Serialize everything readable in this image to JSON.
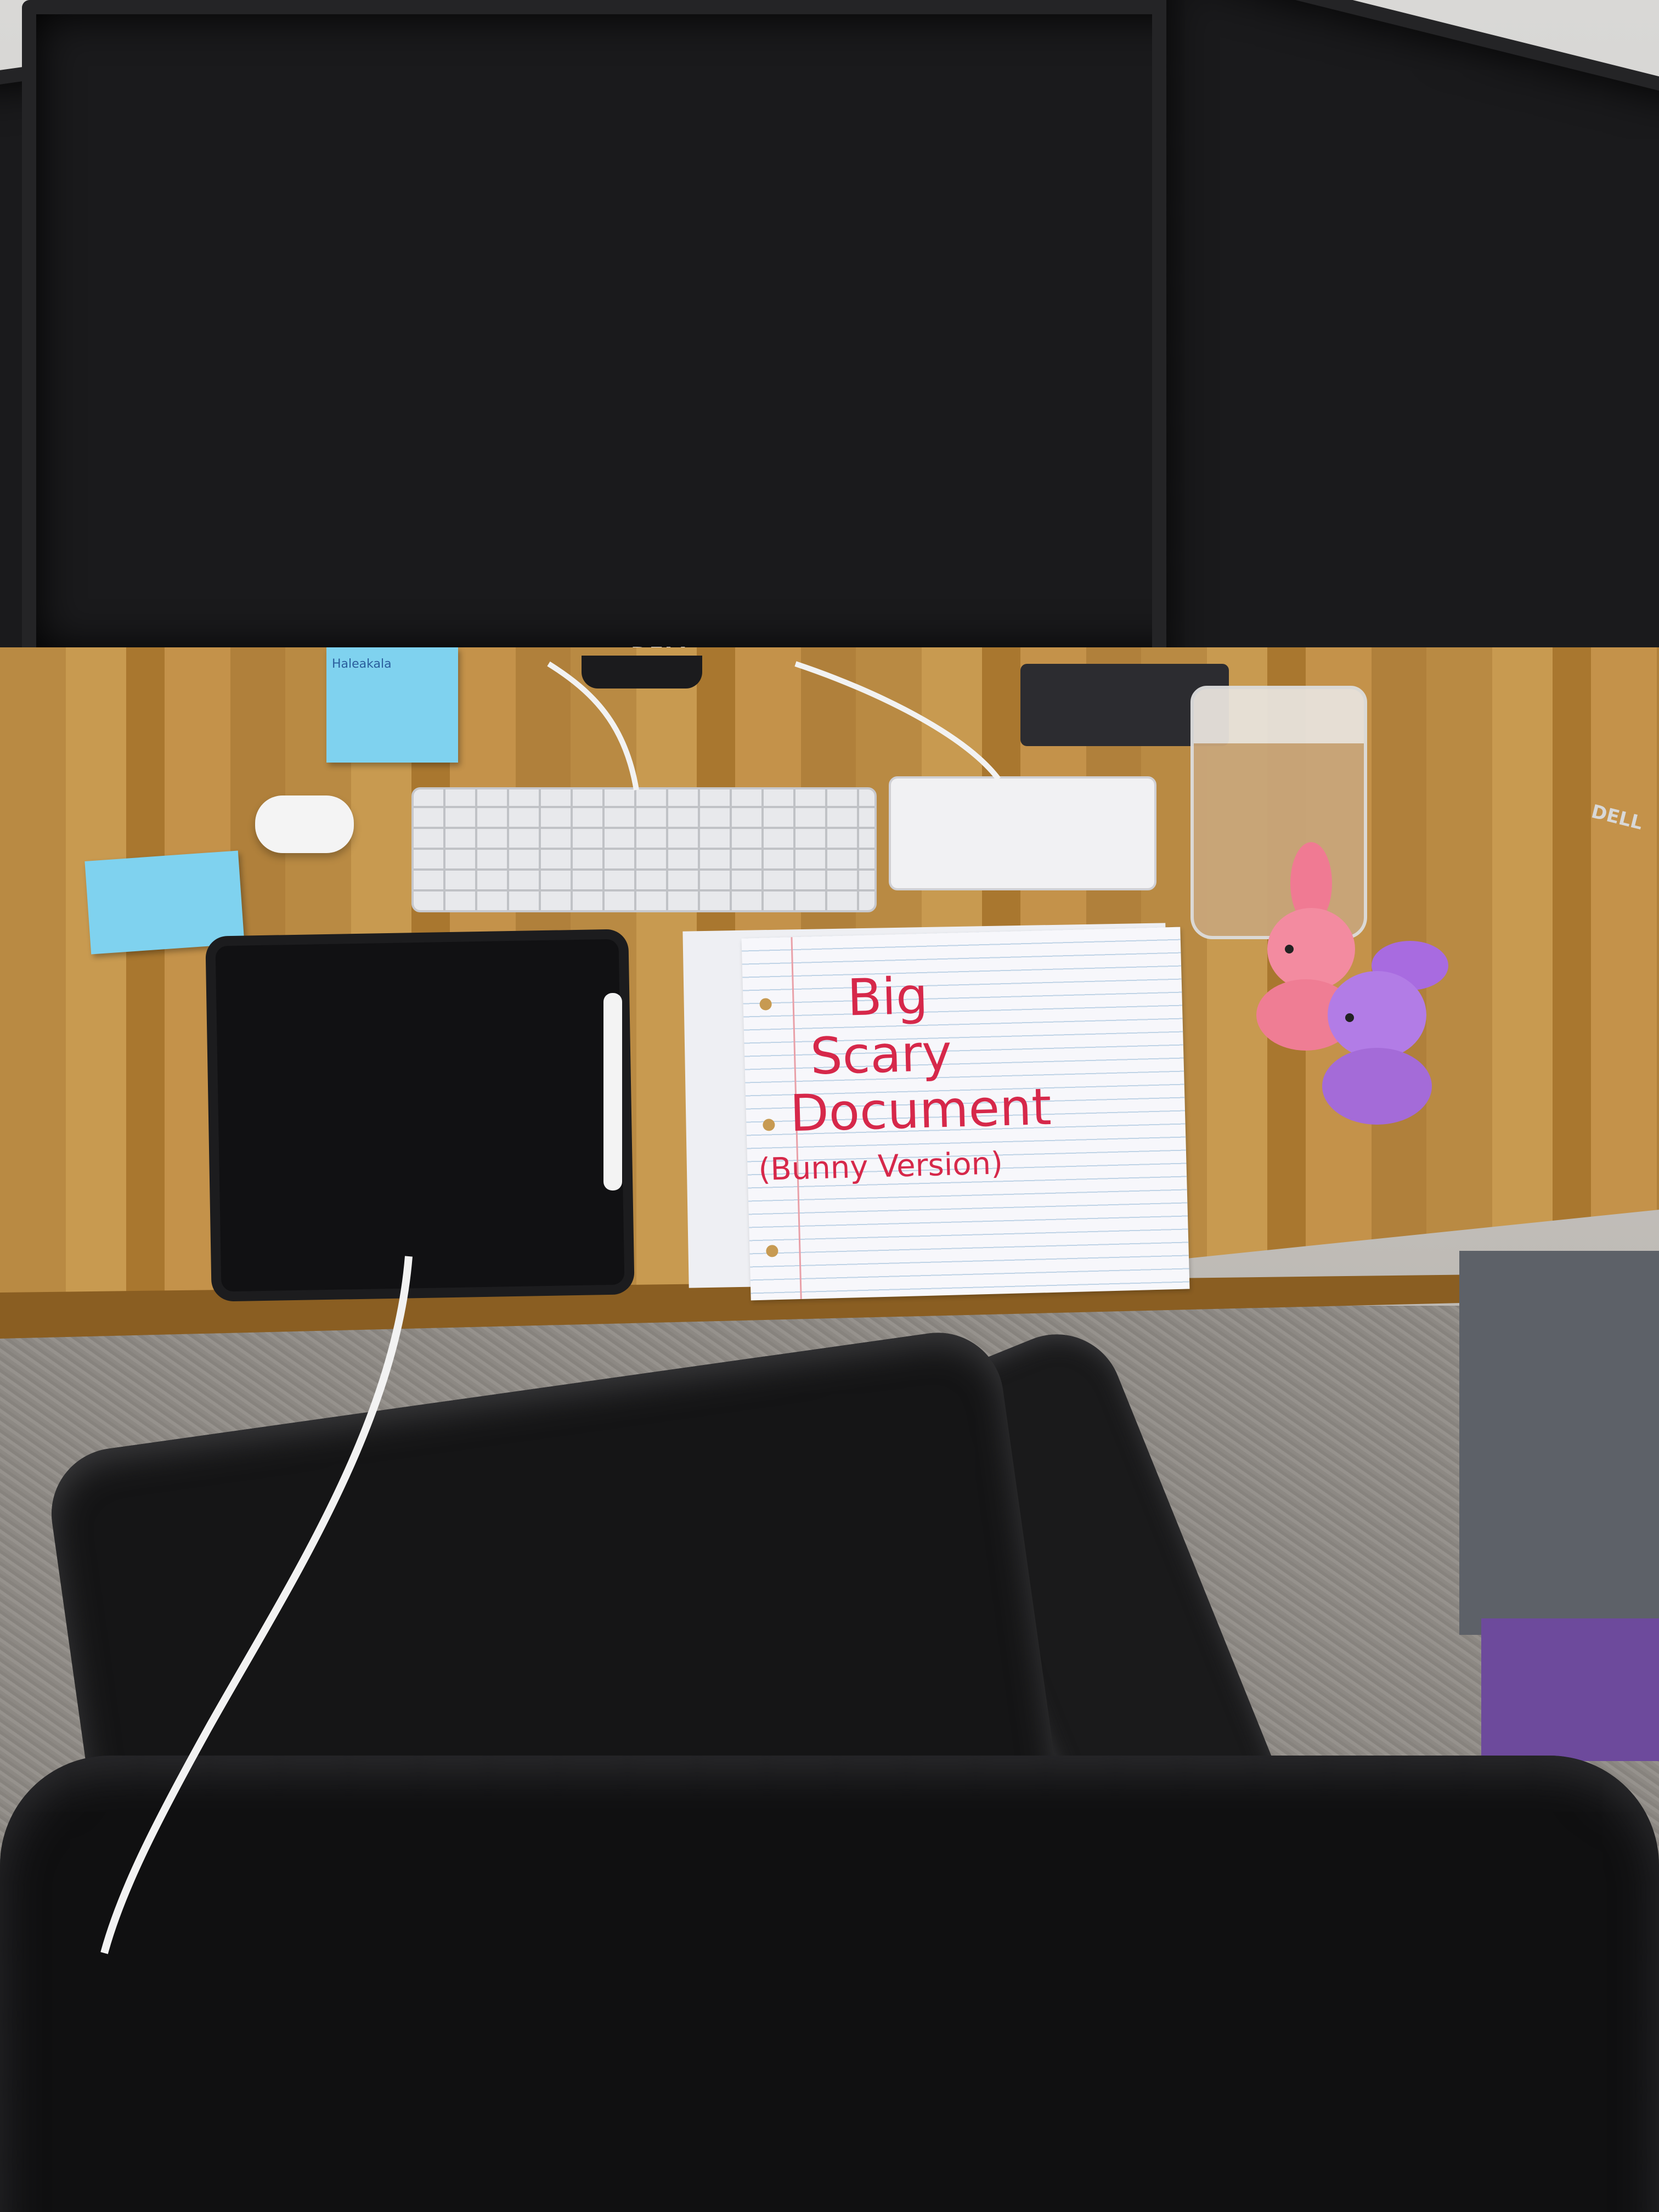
{
  "scene": {
    "description_hidden": "",
    "colors": {
      "desk": "#b98a43",
      "sticky_note": "#7fd2ef",
      "handwriting": "#d6284a",
      "chair": "#101011"
    },
    "monitor_brand": "DELL",
    "sticky_note_text": "Haleakala",
    "paper_text": {
      "line1": "Big",
      "line2": "Scary",
      "line3": "Document",
      "line4": "(Bunny Version)"
    }
  }
}
